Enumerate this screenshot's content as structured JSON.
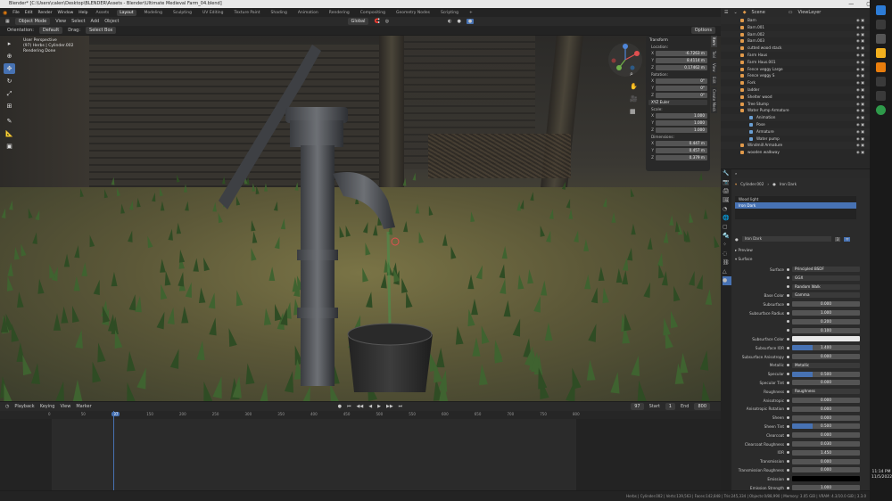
{
  "window": {
    "title": "Blender* [C:\\Users\\calen\\Desktop\\BLENDER\\Assets - Blender\\Ultimate Medieval Farm_04.blend]",
    "controls": [
      "—",
      "▢",
      "✕"
    ]
  },
  "menu": {
    "items": [
      "File",
      "Edit",
      "Render",
      "Window",
      "Help"
    ],
    "workspaces": [
      "Layout",
      "Modeling",
      "Sculpting",
      "UV Editing",
      "Texture Paint",
      "Shading",
      "Animation",
      "Rendering",
      "Compositing",
      "Geometry Nodes",
      "Scripting"
    ],
    "assets_label": "Assets",
    "active_workspace": "Layout",
    "add_tab": "+"
  },
  "viewport_header": {
    "mode": "Object Mode",
    "menus": [
      "View",
      "Select",
      "Add",
      "Object"
    ],
    "orientation_label": "Orientation:",
    "orientation": "Default",
    "drag_label": "Drag:",
    "drag": "Select Box",
    "transform": "Global",
    "options": "Options"
  },
  "viewport_info": {
    "line1": "User Perspective",
    "line2": "(97) Herbs | Cylinder.002",
    "line3": "Rendering Done"
  },
  "npanel": {
    "section": "Transform",
    "location_label": "Location:",
    "location": [
      {
        "axis": "X",
        "value": "-6.7263 m"
      },
      {
        "axis": "Y",
        "value": "8.4114 m"
      },
      {
        "axis": "Z",
        "value": "0.17462 m"
      }
    ],
    "rotation_label": "Rotation:",
    "rotation": [
      {
        "axis": "X",
        "value": "0°"
      },
      {
        "axis": "Y",
        "value": "0°"
      },
      {
        "axis": "Z",
        "value": "0°"
      }
    ],
    "rotation_mode": "XYZ Euler",
    "scale_label": "Scale:",
    "scale": [
      {
        "axis": "X",
        "value": "1.000"
      },
      {
        "axis": "Y",
        "value": "1.000"
      },
      {
        "axis": "Z",
        "value": "1.000"
      }
    ],
    "dimensions_label": "Dimensions:",
    "dimensions": [
      {
        "axis": "X",
        "value": "0.447 m"
      },
      {
        "axis": "Y",
        "value": "0.457 m"
      },
      {
        "axis": "Z",
        "value": "0.379 m"
      }
    ],
    "tabs": [
      "Item",
      "Tool",
      "View",
      "Edit",
      "Create Mesh"
    ]
  },
  "timeline": {
    "menus": [
      "Playback",
      "Keying",
      "View",
      "Marker"
    ],
    "current_frame": "97",
    "start_label": "Start",
    "start": "1",
    "end_label": "End",
    "end": "800",
    "ticks": [
      "0",
      "50",
      "97",
      "150",
      "200",
      "250",
      "300",
      "350",
      "400",
      "450",
      "500",
      "550",
      "600",
      "650",
      "700",
      "750",
      "800"
    ]
  },
  "statusbar": {
    "text": "Herbs | Cylinder.002 | Verts:139,563 | Faces:142,848 | Tris:245,334 | Objects:0/88,990 | Memory: 3.05 GiB | VRAM: 4.3/10.0 GiB | 3.3.0"
  },
  "outliner": {
    "title": "Scene",
    "viewlayer": "ViewLayer",
    "items": [
      {
        "name": "Barn",
        "child": false
      },
      {
        "name": "Barn.001",
        "child": false
      },
      {
        "name": "Barn.002",
        "child": false
      },
      {
        "name": "Barn.003",
        "child": false
      },
      {
        "name": "cutted wood stack",
        "child": false
      },
      {
        "name": "Farm Haus",
        "child": false
      },
      {
        "name": "Farm Haus.001",
        "child": false
      },
      {
        "name": "Fence veggy Large",
        "child": false
      },
      {
        "name": "Fence veggy S",
        "child": false
      },
      {
        "name": "Fork",
        "child": false
      },
      {
        "name": "ladder",
        "child": false
      },
      {
        "name": "Shelter wood",
        "child": false
      },
      {
        "name": "Tree Stump",
        "child": false
      },
      {
        "name": "Water Pump Armature",
        "child": false
      },
      {
        "name": "Animation",
        "child": true
      },
      {
        "name": "Pose",
        "child": true
      },
      {
        "name": "Armature",
        "child": true
      },
      {
        "name": "Water pump",
        "child": true
      },
      {
        "name": "Windmill Armature",
        "child": false
      },
      {
        "name": "wooden walkway",
        "child": false
      }
    ]
  },
  "properties": {
    "object": "Cylinder.002",
    "material_breadcrumb": "Iron Dark",
    "slots": [
      "Wood light",
      "Iron Dark"
    ],
    "material_name": "Iron Dark",
    "users": "3",
    "preview_label": "Preview",
    "surface_label": "Surface",
    "rows": [
      {
        "label": "Surface",
        "value": "Principled BSDF",
        "kind": "dark"
      },
      {
        "label": "",
        "value": "GGX",
        "kind": "dark"
      },
      {
        "label": "",
        "value": "Random Walk",
        "kind": "dark"
      },
      {
        "label": "Base Color",
        "value": "Gamma",
        "kind": "dark"
      },
      {
        "label": "Subsurface",
        "value": "0.000",
        "kind": "num"
      },
      {
        "label": "Subsurface Radius",
        "value": "1.000",
        "kind": "num"
      },
      {
        "label": "",
        "value": "0.200",
        "kind": "num"
      },
      {
        "label": "",
        "value": "0.100",
        "kind": "num"
      },
      {
        "label": "Subsurface Color",
        "value": "",
        "kind": "white"
      },
      {
        "label": "Subsurface IOR",
        "value": "1.400",
        "kind": "blue"
      },
      {
        "label": "Subsurface Anisotropy",
        "value": "0.000",
        "kind": "num"
      },
      {
        "label": "Metallic",
        "value": "Metallic",
        "kind": "dark"
      },
      {
        "label": "Specular",
        "value": "0.500",
        "kind": "blue"
      },
      {
        "label": "Specular Tint",
        "value": "0.000",
        "kind": "num"
      },
      {
        "label": "Roughness",
        "value": "Roughness",
        "kind": "dark"
      },
      {
        "label": "Anisotropic",
        "value": "0.000",
        "kind": "num"
      },
      {
        "label": "Anisotropic Rotation",
        "value": "0.000",
        "kind": "num"
      },
      {
        "label": "Sheen",
        "value": "0.000",
        "kind": "num"
      },
      {
        "label": "Sheen Tint",
        "value": "0.500",
        "kind": "blue"
      },
      {
        "label": "Clearcoat",
        "value": "0.000",
        "kind": "num"
      },
      {
        "label": "Clearcoat Roughness",
        "value": "0.030",
        "kind": "num"
      },
      {
        "label": "IOR",
        "value": "1.450",
        "kind": "num"
      },
      {
        "label": "Transmission",
        "value": "0.000",
        "kind": "num"
      },
      {
        "label": "Transmission Roughness",
        "value": "0.000",
        "kind": "num"
      },
      {
        "label": "Emission",
        "value": "",
        "kind": "black"
      },
      {
        "label": "Emission Strength",
        "value": "1.000",
        "kind": "num"
      }
    ]
  },
  "clock": {
    "time": "11:14 PM",
    "date": "11/5/2022"
  },
  "colors": {
    "accent": "#4772b3",
    "outliner_icon": "#e19a4b",
    "object_icon": "#3aa55e"
  }
}
